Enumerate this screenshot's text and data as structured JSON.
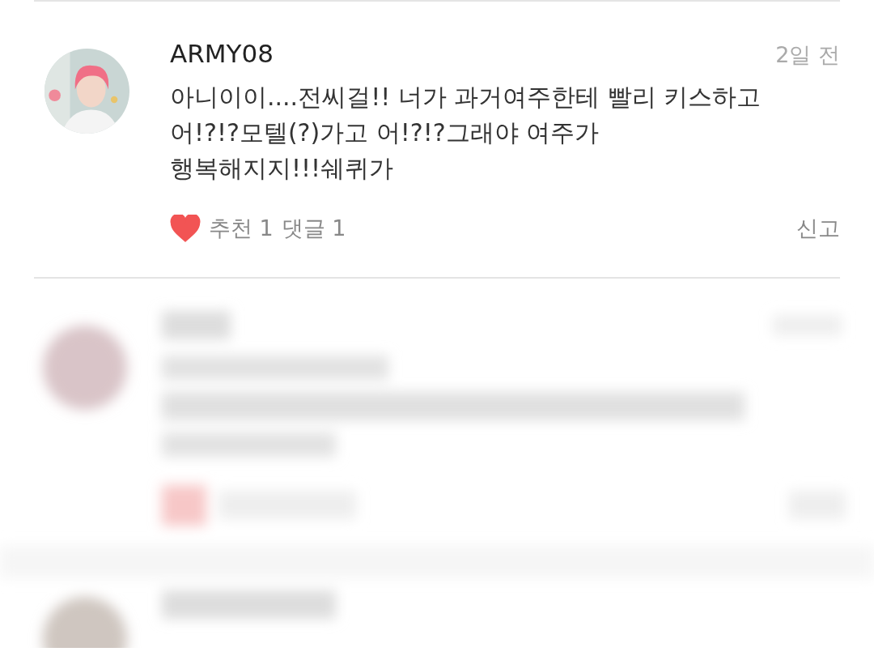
{
  "comment": {
    "author": "ARMY08",
    "time": "2일 전",
    "text": "아니이이....전씨걸!! 너가 과거여주한테 빨리 키스하고\n어!?!?모텔(?)가고 어!?!?그래야 여주가\n행복해지지!!!쉐퀴가",
    "liked": true,
    "likes": "추천 1",
    "replies": "댓글 1",
    "report": "신고"
  }
}
